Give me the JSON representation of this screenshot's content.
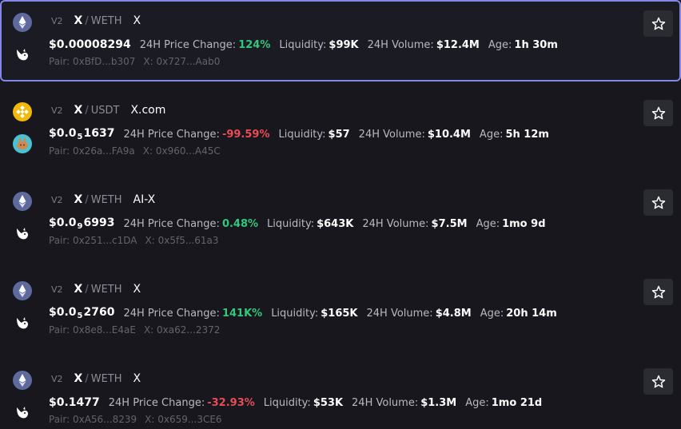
{
  "rows": [
    {
      "version": "V2",
      "base": "X",
      "quote": "WETH",
      "name": "X",
      "chain_icon": "ethereum-icon",
      "dex_icon": "uniswap-icon",
      "price_main": "$0.00008294",
      "price_zeros": "",
      "price_tail": "",
      "change_label": "24H Price Change:",
      "change": "124%",
      "change_dir": "up",
      "liq_label": "Liquidity:",
      "liquidity": "$99K",
      "vol_label": "24H Volume:",
      "volume": "$12.4M",
      "age_label": "Age:",
      "age": "1h 30m",
      "pair": "Pair: 0xBfD...b307",
      "token": "X: 0x727...Aab0",
      "favorite_icon": "star-icon"
    },
    {
      "version": "V2",
      "base": "X",
      "quote": "USDT",
      "name": "X.com",
      "chain_icon": "binance-icon",
      "dex_icon": "pancakeswap-icon",
      "price_main": "$0.0",
      "price_zeros": "5",
      "price_tail": "1637",
      "change_label": "24H Price Change:",
      "change": "-99.59%",
      "change_dir": "down",
      "liq_label": "Liquidity:",
      "liquidity": "$57",
      "vol_label": "24H Volume:",
      "volume": "$10.4M",
      "age_label": "Age:",
      "age": "5h 12m",
      "pair": "Pair: 0x26a...FA9a",
      "token": "X: 0x960...A45C",
      "favorite_icon": "star-icon"
    },
    {
      "version": "V2",
      "base": "X",
      "quote": "WETH",
      "name": "AI-X",
      "chain_icon": "ethereum-icon",
      "dex_icon": "uniswap-icon",
      "price_main": "$0.0",
      "price_zeros": "9",
      "price_tail": "6993",
      "change_label": "24H Price Change:",
      "change": "0.48%",
      "change_dir": "up",
      "liq_label": "Liquidity:",
      "liquidity": "$643K",
      "vol_label": "24H Volume:",
      "volume": "$7.5M",
      "age_label": "Age:",
      "age": "1mo 9d",
      "pair": "Pair: 0x251...c1DA",
      "token": "X: 0x5f5...61a3",
      "favorite_icon": "star-icon"
    },
    {
      "version": "V2",
      "base": "X",
      "quote": "WETH",
      "name": "X",
      "chain_icon": "ethereum-icon",
      "dex_icon": "uniswap-icon",
      "price_main": "$0.0",
      "price_zeros": "5",
      "price_tail": "2760",
      "change_label": "24H Price Change:",
      "change": "141K%",
      "change_dir": "up",
      "liq_label": "Liquidity:",
      "liquidity": "$165K",
      "vol_label": "24H Volume:",
      "volume": "$4.8M",
      "age_label": "Age:",
      "age": "20h 14m",
      "pair": "Pair: 0x8e8...E4aE",
      "token": "X: 0xa62...2372",
      "favorite_icon": "star-icon"
    },
    {
      "version": "V2",
      "base": "X",
      "quote": "WETH",
      "name": "X",
      "chain_icon": "ethereum-icon",
      "dex_icon": "uniswap-icon",
      "price_main": "$0.1477",
      "price_zeros": "",
      "price_tail": "",
      "change_label": "24H Price Change:",
      "change": "-32.93%",
      "change_dir": "down",
      "liq_label": "Liquidity:",
      "liquidity": "$53K",
      "vol_label": "24H Volume:",
      "volume": "$1.3M",
      "age_label": "Age:",
      "age": "1mo 21d",
      "pair": "Pair: 0xA56...8239",
      "token": "X: 0x659...3CE6",
      "favorite_icon": "star-icon"
    }
  ],
  "colors": {
    "up": "#34c77b",
    "down": "#ea4c55",
    "selected_border": "#8287e8"
  }
}
